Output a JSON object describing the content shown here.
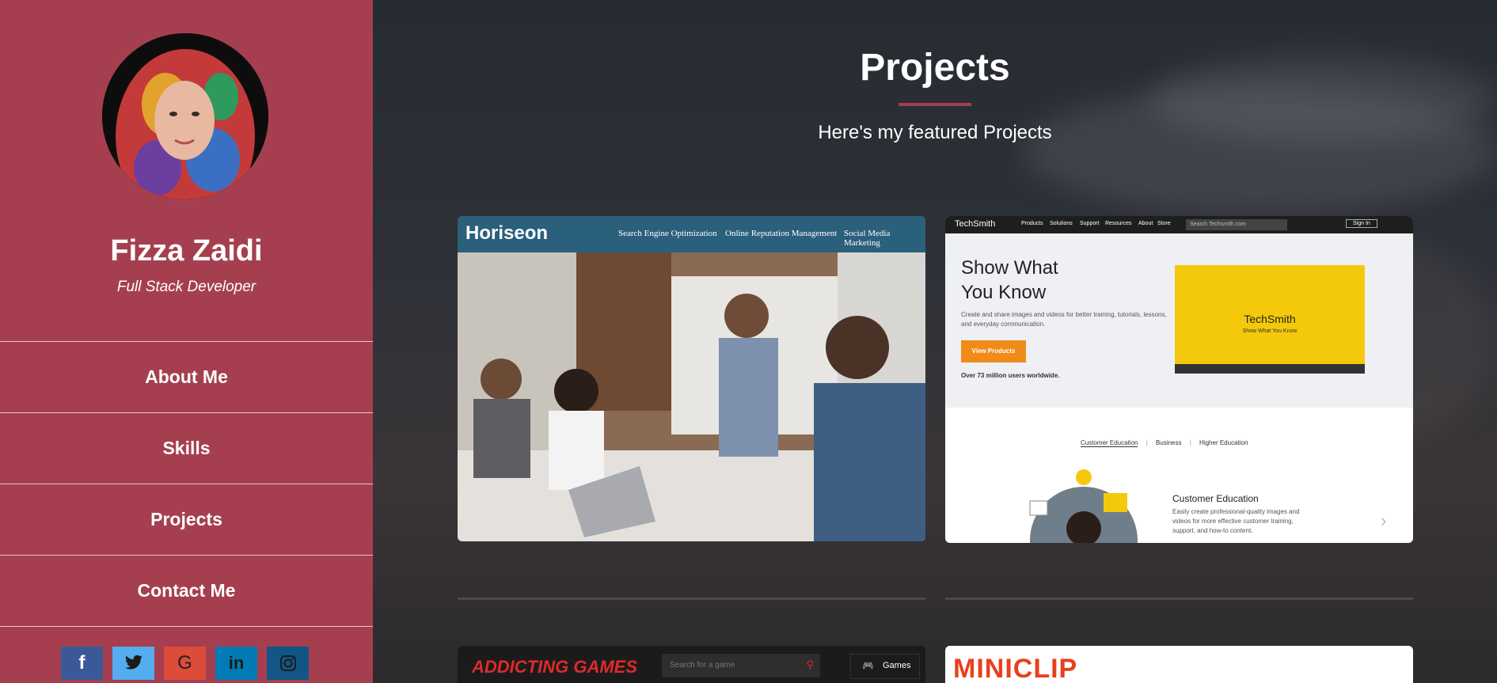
{
  "profile": {
    "name": "Fizza Zaidi",
    "role": "Full Stack Developer"
  },
  "nav": {
    "items": [
      {
        "label": "About Me"
      },
      {
        "label": "Skills"
      },
      {
        "label": "Projects"
      },
      {
        "label": "Contact Me"
      }
    ]
  },
  "social": [
    {
      "icon": "facebook-icon",
      "glyph": "f",
      "color": "#3b5998"
    },
    {
      "icon": "twitter-icon",
      "glyph": "🐦",
      "color": "#55acee"
    },
    {
      "icon": "google-icon",
      "glyph": "G",
      "color": "#dd4b39"
    },
    {
      "icon": "linkedin-icon",
      "glyph": "in",
      "color": "#007bb5"
    },
    {
      "icon": "instagram-icon",
      "glyph": "◎",
      "color": "#125688"
    }
  ],
  "section": {
    "title": "Projects",
    "subtitle": "Here's my featured Projects"
  },
  "projects": {
    "horiseon": {
      "logo": "Horiseon",
      "nav": [
        "Search Engine Optimization",
        "Online Reputation Management",
        "Social Media Marketing"
      ]
    },
    "techsmith": {
      "logo": "TechSmith",
      "nav": [
        "Products",
        "Solutions",
        "Support",
        "Resources",
        "About",
        "Store"
      ],
      "search_placeholder": "Search Techsmith.com",
      "signin": "Sign In",
      "headline_1": "Show What",
      "headline_2": "You Know",
      "desc": "Create and share images and videos for better training, tutorials, lessons, and everyday communication.",
      "cta": "View Products",
      "users": "Over 73 million users worldwide.",
      "video_logo": "TechSmith",
      "video_tag": "Show What You Know",
      "tabs": [
        "Customer Education",
        "Business",
        "Higher Education"
      ],
      "feature_title": "Customer Education",
      "feature_desc": "Easily create professional-quality images and videos for more effective customer training, support, and how-to content."
    },
    "addicting": {
      "logo": "ADDICTING GAMES",
      "search_placeholder": "Search for a game",
      "games": "Games"
    },
    "miniclip": {
      "logo": "MINICLIP"
    }
  },
  "colors": {
    "sidebar": "#a53f4f",
    "accent": "#a53f4f"
  }
}
